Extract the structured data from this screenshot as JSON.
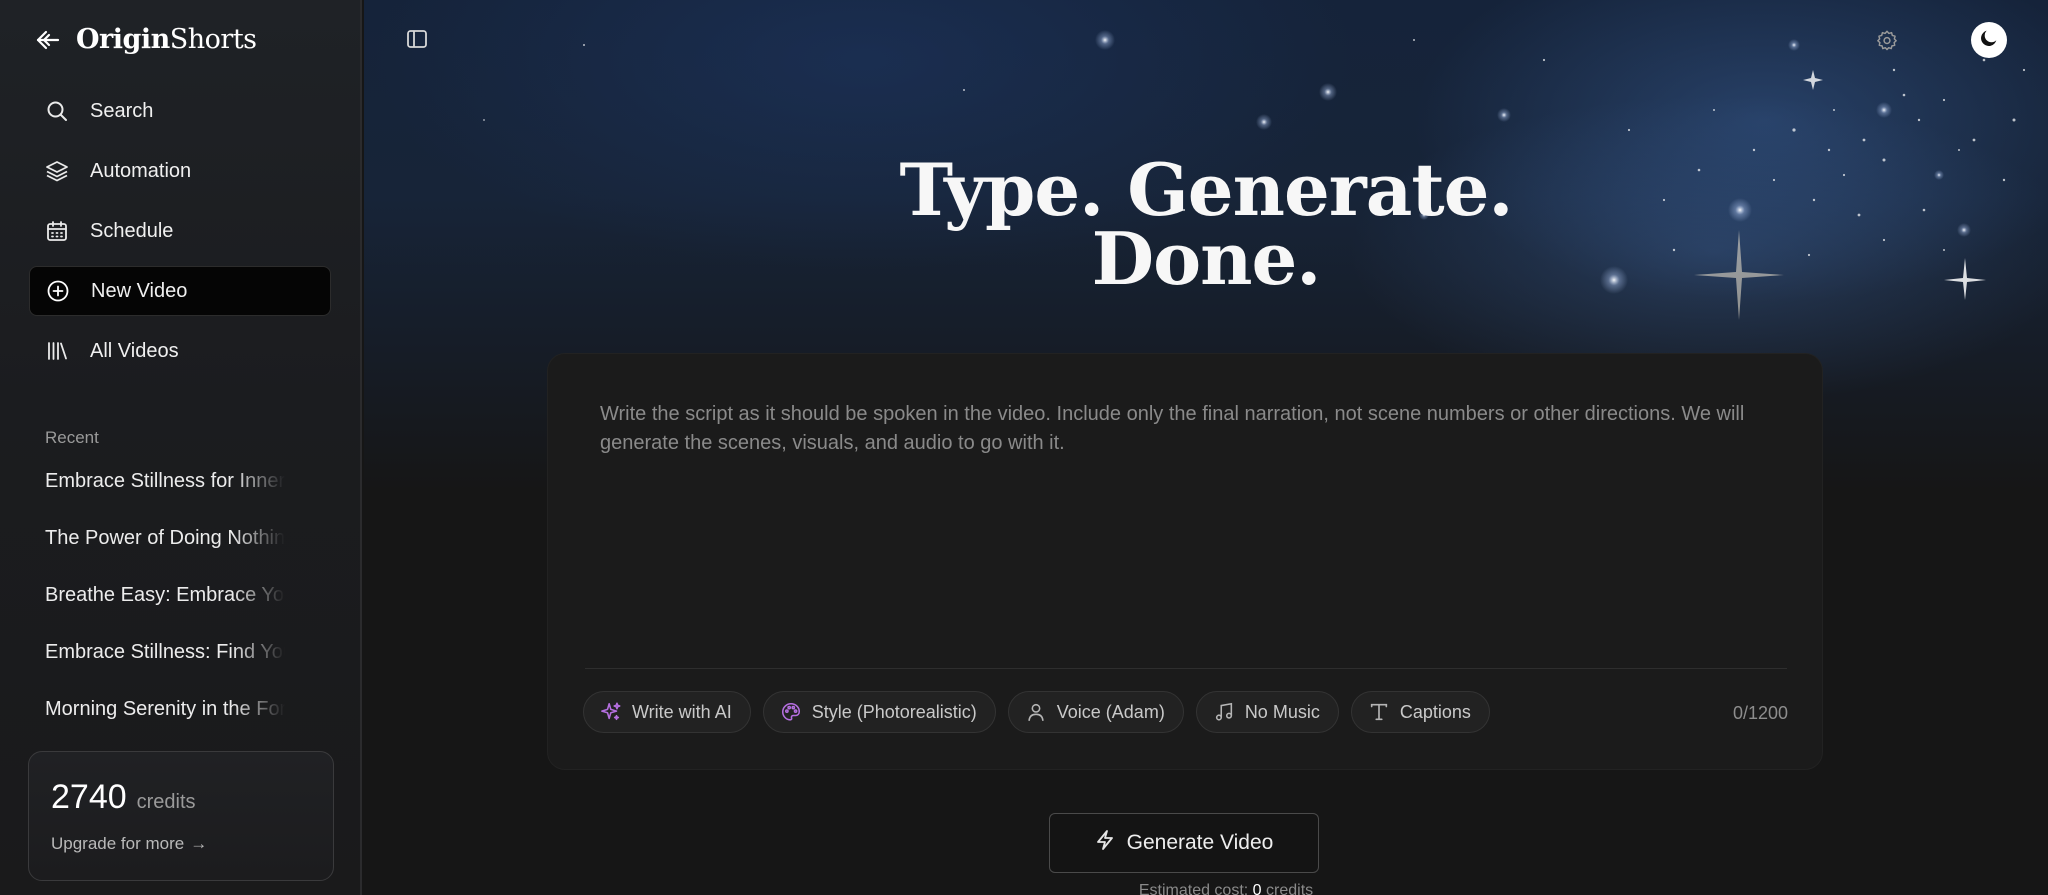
{
  "brand": {
    "name_bold": "Origin",
    "name_rest": "Shorts"
  },
  "nav": {
    "items": [
      {
        "label": "Search",
        "icon": "search-icon"
      },
      {
        "label": "Automation",
        "icon": "layers-icon"
      },
      {
        "label": "Schedule",
        "icon": "calendar-icon"
      },
      {
        "label": "New Video",
        "icon": "plus-circle-icon",
        "active": true
      },
      {
        "label": "All Videos",
        "icon": "library-icon"
      }
    ]
  },
  "recent": {
    "label": "Recent",
    "items": [
      "Embrace Stillness for Inner Peace",
      "The Power of Doing Nothing",
      "Breathe Easy: Embrace Your Calm",
      "Embrace Stillness: Find Your Center",
      "Morning Serenity in the Forest"
    ]
  },
  "credits": {
    "amount": "2740",
    "unit": "credits",
    "upgrade_label": "Upgrade for more",
    "upgrade_arrow": "→"
  },
  "hero": {
    "line1": "Type. Generate.",
    "line2": "Done."
  },
  "composer": {
    "placeholder": "Write the script as it should be spoken in the video. Include only the final narration, not scene numbers or other directions. We will generate the scenes, visuals, and audio to go with it.",
    "value": "",
    "counter": "0/1200",
    "chips": [
      {
        "label": "Write with AI",
        "icon": "sparkles-icon"
      },
      {
        "label": "Style (Photorealistic)",
        "icon": "palette-icon"
      },
      {
        "label": "Voice (Adam)",
        "icon": "user-icon"
      },
      {
        "label": "No Music",
        "icon": "music-icon"
      },
      {
        "label": "Captions",
        "icon": "text-icon"
      }
    ]
  },
  "generate": {
    "label": "Generate Video",
    "icon": "lightning-icon"
  },
  "estimate": {
    "prefix": "Estimated cost:",
    "amount": "0",
    "suffix": "credits"
  },
  "colors": {
    "accent_purple": "#b56fe0",
    "background": "#161616",
    "sidebar": "#1c1d20"
  }
}
